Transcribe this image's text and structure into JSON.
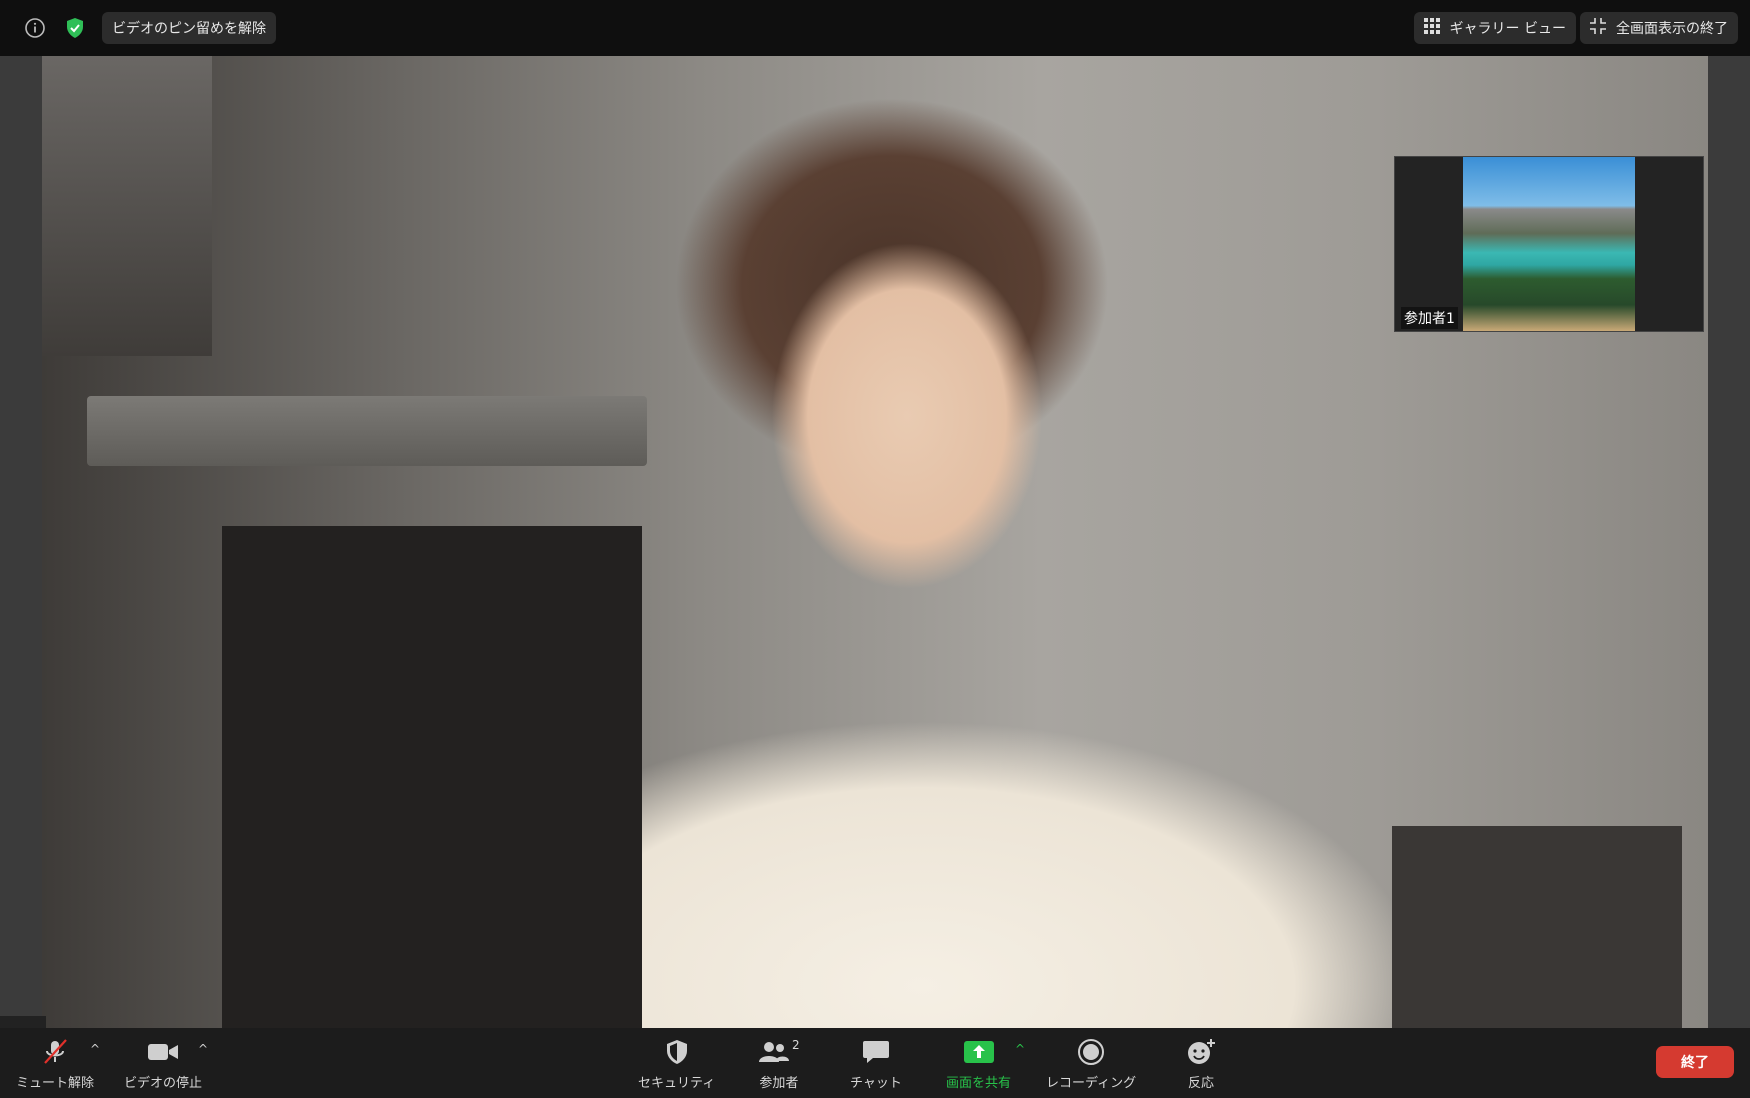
{
  "top_bar": {
    "unpin_label": "ビデオのピン留めを解除",
    "gallery_view_label": "ギャラリー ビュー",
    "exit_fullscreen_label": "全画面表示の終了",
    "icons": {
      "info": "info-icon",
      "security": "shield-check-icon",
      "gallery": "grid-icon",
      "exit_fullscreen": "collapse-icon"
    }
  },
  "thumbnail": {
    "label": "参加者1"
  },
  "toolbar": {
    "unmute_label": "ミュート解除",
    "stop_video_label": "ビデオの停止",
    "security_label": "セキュリティ",
    "participants_label": "参加者",
    "participants_count": "2",
    "chat_label": "チャット",
    "share_screen_label": "画面を共有",
    "recording_label": "レコーディング",
    "reactions_label": "反応",
    "end_label": "終了",
    "caret": "^",
    "colors": {
      "end_button": "#d53a30",
      "share_accent": "#28c24a",
      "mute_slash": "#e0302a"
    }
  }
}
